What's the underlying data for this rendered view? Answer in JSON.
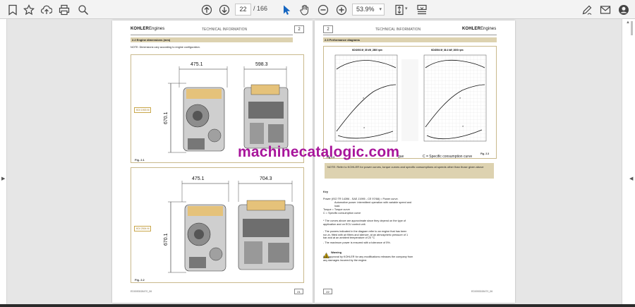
{
  "toolbar": {
    "current_page": "22",
    "page_separator": "/",
    "total_pages": "166",
    "zoom": "53.9%"
  },
  "page_left": {
    "brand": "KOHLER",
    "brand_suffix": "Engines",
    "header_title": "TECHNICAL INFORMATION",
    "header_num": "2",
    "section": "2.2 Engine dimensions (mm)",
    "note": "NOTE: Dimensions vary according to engine configuration.",
    "fig1": {
      "model": "KDI 1903 M",
      "dim_w1": "475.1",
      "dim_w2": "598.3",
      "dim_h": "670.1",
      "label": "Fig. 2.1"
    },
    "fig2": {
      "model": "KDI 2504 M",
      "dim_w1": "475.1",
      "dim_w2": "704.3",
      "dim_h": "670.1",
      "label": "Fig. 2.2"
    },
    "footer_code": "ED0053026470_06",
    "page_number": "21"
  },
  "page_right": {
    "brand": "KOHLER",
    "brand_suffix": "Engines",
    "header_title": "TECHNICAL INFORMATION",
    "header_num": "2",
    "section": "2.3 Performance diagrams",
    "chart1_title": "KDI1903 M_35 kW_2800 rpm",
    "chart2_title": "KDI2504 M_36.4 kW_2600 rpm",
    "fig_label": "Fig. 2.3",
    "fig_label2": "Fig 2.3",
    "curve_c_prefix": "gue",
    "curve_c": "C = Specific consumption curve",
    "note_box": "NOTE: Refer to KOHLER for power curves, torque curves and specific consumptions at speeds other than those given above",
    "key": "Key",
    "power_label": "Power (ISO TR 14396 - SAE J1995 - CE 97/68) = Power curve.",
    "power_desc": "Automotive power: intermittent operation with variable speed and load.",
    "torque": "Torque   = Torque curve",
    "c_label": "C         = Specific consumption curve",
    "bullet1": "* The curves above are approximate since they depend on the type of application and on ECU control unit.",
    "bullet2": "- The powers indicated in the diagram refer to an engine that has been run-in, fitted with air filters and silencer, at an atmospheric pressure of 1 bar and at an ambient temperature of 20 °C",
    "bullet3": "- The maximum power is ensured with a tolerance of 5%.",
    "warning_title": "Warning",
    "warning_text": "Non-approval by KOHLER for any modifications releases the company from any damages incurred by the engine.",
    "footer_code": "ED0053026470_06",
    "page_number": "22"
  },
  "watermark": "machinecatalogic.com"
}
